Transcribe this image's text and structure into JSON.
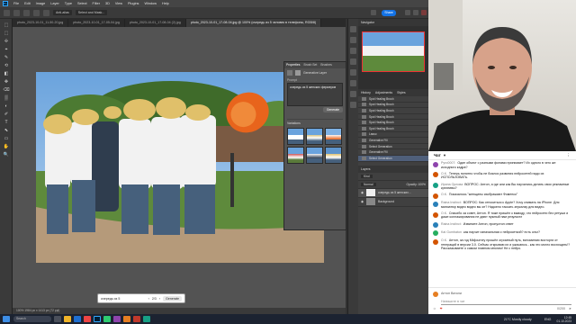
{
  "menubar": {
    "items": [
      "File",
      "Edit",
      "Image",
      "Layer",
      "Type",
      "Select",
      "Filter",
      "3D",
      "View",
      "Plugins",
      "Window",
      "Help"
    ]
  },
  "optbar": {
    "labels": [
      "Anti-alias",
      "Select and Mask..."
    ]
  },
  "share_label": "Share",
  "tabs": [
    {
      "label": "photo_2023-10-01_11-50-20.jpg"
    },
    {
      "label": "photo_2023-10-01_17-05-04.jpg"
    },
    {
      "label": "photo_2023-10-01_17-08-04 (2).jpg"
    },
    {
      "label": "photo_2023-10-01_17-08-04.jpg @ 100% (очередь из 5 человек в телефоны, RGB/8)",
      "active": true
    }
  ],
  "tools": [
    "⬚",
    "⬚",
    "✢",
    "⌖",
    "✎",
    "⟲",
    "◧",
    "✥",
    "⌫",
    "▒",
    "◐",
    "✐",
    "T",
    "⬉",
    "▭",
    "✋",
    "🔍"
  ],
  "properties": {
    "tabs": [
      "Properties",
      "Brush Set",
      "Brushes"
    ],
    "layer_type": "Generative Layer",
    "prompt_label": "Prompt",
    "prompt_value": "очередь из 5 женских фермеров",
    "generate_label": "Generate",
    "variations_label": "Variations"
  },
  "context_bar": {
    "input": "очередь из 5",
    "page": "2/3",
    "generate": "Generate"
  },
  "status_text": "100%   1984 px x 1413 px (72 ppi)",
  "navigator_label": "Navigator",
  "history": {
    "tabs": [
      "History",
      "Adjustments",
      "Styles"
    ],
    "items": [
      "Spot Healing Brush",
      "Spot Healing Brush",
      "Spot Healing Brush",
      "Spot Healing Brush",
      "Spot Healing Brush",
      "Spot Healing Brush",
      "Lasso",
      "Generative Fill",
      "Select Generation",
      "Generative Fill",
      "Select Generation"
    ]
  },
  "layers": {
    "tab": "Layers",
    "kind": "Kind",
    "blend": "Normal",
    "opacity": "Opacity: 100%",
    "items": [
      "очередь из 5 женских...",
      "Background"
    ]
  },
  "chat": {
    "title": "Чат",
    "messages": [
      {
        "author": "Pyro0007:",
        "text": "Один объект с разными фонами принимает? Их одного в чего же исходного кадра?",
        "color": "#8e44ad"
      },
      {
        "author": "О.К.",
        "text": "Теперь понятно чтобы не боялся развития нейросетей надо их ИСПОЛЬЗОВАТЬ.",
        "color": "#d35400"
      },
      {
        "author": "Ирина Орлова",
        "text": "ВОПРОС: Антон, а где али как Вы научились делать свои рекламные креативы?",
        "color": "#16a085"
      },
      {
        "author": "О.К.",
        "text": "Показалось \"женщины изображают Фоменко\"",
        "color": "#d35400"
      },
      {
        "author": "Raina Instinct:",
        "text": "ВОПРОС: Как относиться к Apple? Хочу снимать на iPhone. Для миниатюр видео видео вы он? Надоело таскать зеркалку для видео.",
        "color": "#2980b9"
      },
      {
        "author": "О.К.",
        "text": "Спасибо за совет, Антон. Я тоже пришёл к выводу, что нейросети без ретуши и даже коллажирования не дают нужный нам результат",
        "color": "#d35400"
      },
      {
        "author": "Raina Instinct:",
        "text": "Извините Антон, пропустил ответ",
        "color": "#2980b9"
      },
      {
        "author": "Kai Gumbaton",
        "text": "как научит изначальная с нейросеткой? есть ольг?",
        "color": "#27ae60"
      },
      {
        "author": "О.К.",
        "text": "Антон, за год Midjourney прошёл огромный путь, вспоминаю восторги от генераций в версии 3.0. Сейчас открываю их и ужасаюсь - как это могло восхищать!? Рассказываете о самом главном многим! Не с нейро.",
        "color": "#d35400"
      }
    ],
    "you_name": "Антон Ватоли",
    "input_placeholder": "Напишите в чат",
    "counter": "0/200"
  },
  "taskbar": {
    "search": "Search",
    "weather": "21°C  Mostly cloudy",
    "lang": "ENG",
    "time": "12:45",
    "date": "01.10.2023"
  }
}
